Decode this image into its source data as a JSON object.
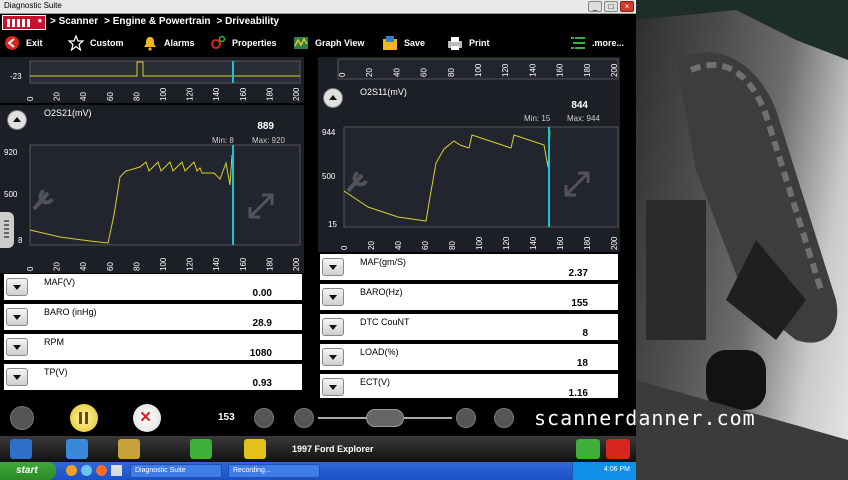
{
  "window": {
    "title": "Diagnostic Suite"
  },
  "breadcrumbs": [
    "> Scanner",
    "> Engine & Powertrain",
    "> Driveability"
  ],
  "toolbar": [
    {
      "label": "Exit",
      "icon": "exit-icon"
    },
    {
      "label": "Custom",
      "icon": "star-icon"
    },
    {
      "label": "Alarms",
      "icon": "bell-icon"
    },
    {
      "label": "Properties",
      "icon": "properties-icon"
    },
    {
      "label": "Graph View",
      "icon": "graph-icon"
    },
    {
      "label": "Save",
      "icon": "save-icon"
    },
    {
      "label": "Print",
      "icon": "print-icon"
    },
    {
      "label": ".more...",
      "icon": "list-icon"
    }
  ],
  "x_ticks": [
    "0",
    "20",
    "40",
    "60",
    "80",
    "100",
    "120",
    "140",
    "160",
    "180",
    "200"
  ],
  "top_left_strip": {
    "y_tick": "-23"
  },
  "o2s21": {
    "name": "O2S21(mV)",
    "value": "889",
    "min_label": "Min: 8",
    "max_label": "Max: 920",
    "y_ticks": [
      "920",
      "500",
      "8"
    ]
  },
  "o2s11": {
    "name": "O2S11(mV)",
    "value": "844",
    "min_label": "Min: 15",
    "max_label": "Max: 944",
    "y_ticks": [
      "944",
      "500",
      "15"
    ]
  },
  "left_params": [
    {
      "name": "MAF(V)",
      "value": "0.00"
    },
    {
      "name": "BARO (inHg)",
      "value": "28.9"
    },
    {
      "name": "RPM",
      "value": "1080"
    },
    {
      "name": "TP(V)",
      "value": "0.93"
    }
  ],
  "right_params": [
    {
      "name": "MAF(gm/S)",
      "value": "2.37"
    },
    {
      "name": "BARO(Hz)",
      "value": "155"
    },
    {
      "name": "DTC CouNT",
      "value": "8"
    },
    {
      "name": "LOAD(%)",
      "value": "18"
    },
    {
      "name": "ECT(V)",
      "value": "1.16"
    }
  ],
  "playback": {
    "frame": "153"
  },
  "vehicle": "1997 Ford Explorer",
  "taskbar": {
    "start": "start",
    "tasks": [
      "Diagnostic Suite",
      "Recording..."
    ],
    "clock": "4:06 PM"
  },
  "watermark": "scannerdanner.com",
  "colors": {
    "trace": "#d8d02a",
    "cursor": "#17c4d8",
    "panel": "#1d1f27",
    "brand": "#c8102e"
  }
}
